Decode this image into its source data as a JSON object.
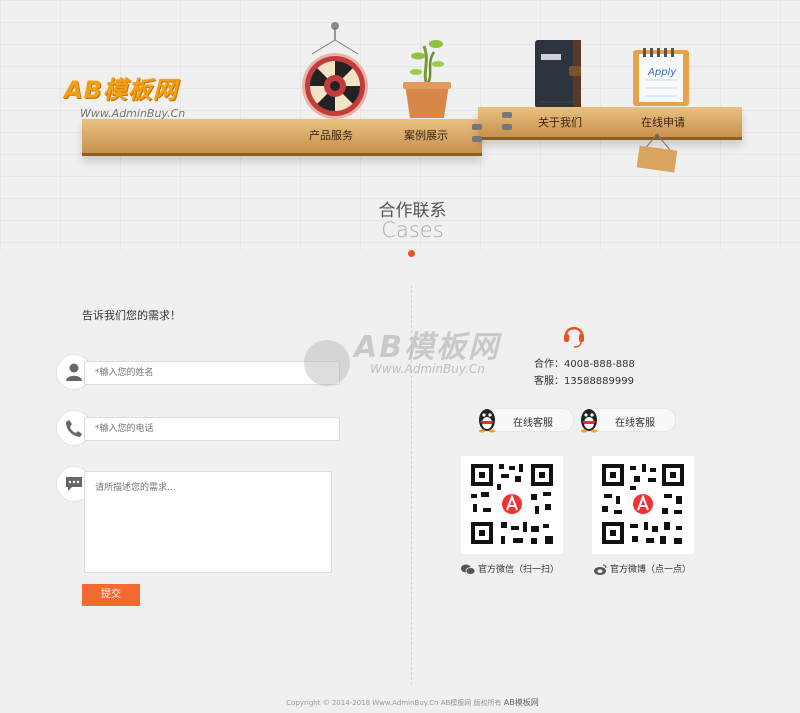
{
  "brand": {
    "logo_text": "AB模板网",
    "logo_url_text": "Www.AdminBuy.Cn"
  },
  "nav": {
    "items": [
      {
        "label": "产品服务"
      },
      {
        "label": "案例展示"
      },
      {
        "label": "关于我们"
      },
      {
        "label": "在线申请"
      }
    ],
    "notebook_label": "Apply"
  },
  "section": {
    "title": "合作联系",
    "subtitle": "Cases"
  },
  "form": {
    "heading": "告诉我们您的需求！",
    "name_placeholder": "*输入您的姓名",
    "phone_placeholder": "*输入您的电话",
    "message_placeholder": "请所描述您的需求...",
    "submit_label": "提交"
  },
  "watermark": {
    "text": "AB模板网",
    "url": "Www.AdminBuy.Cn"
  },
  "contact": {
    "cooperation": "合作：4008-888-888",
    "service": "客服：13588889999",
    "qq_buttons": [
      {
        "label": "在线客服"
      },
      {
        "label": "在线客服"
      }
    ],
    "qr_codes": [
      {
        "caption": "官方微信（扫一扫）",
        "icon": "wechat-icon"
      },
      {
        "caption": "官方微博（点一点）",
        "icon": "weibo-icon"
      }
    ]
  },
  "footer": {
    "copyright": "Copyright © 2014-2018 Www.AdminBuy.Cn AB模板网 版权所有",
    "brand_link": "AB模板网"
  },
  "colors": {
    "accent": "#f36b32",
    "logo": "#f2a012",
    "shelf": "#d9a45f"
  }
}
